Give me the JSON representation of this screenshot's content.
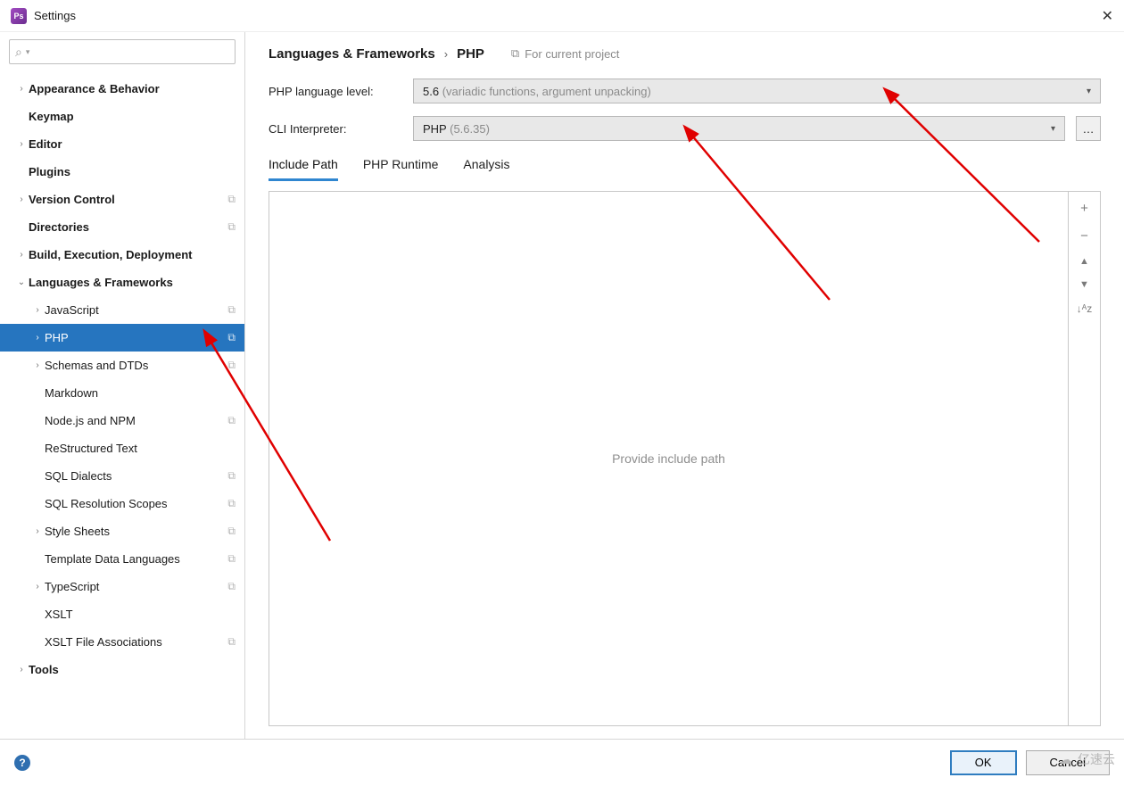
{
  "window": {
    "title": "Settings"
  },
  "sidebar": {
    "search_placeholder": "",
    "items": [
      {
        "label": "Appearance & Behavior",
        "bold": true,
        "arrow": "right",
        "depth": 1
      },
      {
        "label": "Keymap",
        "bold": true,
        "arrow": "none",
        "depth": 1
      },
      {
        "label": "Editor",
        "bold": true,
        "arrow": "right",
        "depth": 1
      },
      {
        "label": "Plugins",
        "bold": true,
        "arrow": "none",
        "depth": 1
      },
      {
        "label": "Version Control",
        "bold": true,
        "arrow": "right",
        "depth": 1,
        "badge": true
      },
      {
        "label": "Directories",
        "bold": true,
        "arrow": "none",
        "depth": 1,
        "badge": true
      },
      {
        "label": "Build, Execution, Deployment",
        "bold": true,
        "arrow": "right",
        "depth": 1
      },
      {
        "label": "Languages & Frameworks",
        "bold": true,
        "arrow": "down",
        "depth": 1
      },
      {
        "label": "JavaScript",
        "arrow": "right",
        "depth": 2,
        "badge": true
      },
      {
        "label": "PHP",
        "arrow": "right",
        "depth": 2,
        "badge": true,
        "selected": true
      },
      {
        "label": "Schemas and DTDs",
        "arrow": "right",
        "depth": 2,
        "badge": true
      },
      {
        "label": "Markdown",
        "arrow": "none",
        "depth": 2
      },
      {
        "label": "Node.js and NPM",
        "arrow": "none",
        "depth": 2,
        "badge": true
      },
      {
        "label": "ReStructured Text",
        "arrow": "none",
        "depth": 2
      },
      {
        "label": "SQL Dialects",
        "arrow": "none",
        "depth": 2,
        "badge": true
      },
      {
        "label": "SQL Resolution Scopes",
        "arrow": "none",
        "depth": 2,
        "badge": true
      },
      {
        "label": "Style Sheets",
        "arrow": "right",
        "depth": 2,
        "badge": true
      },
      {
        "label": "Template Data Languages",
        "arrow": "none",
        "depth": 2,
        "badge": true
      },
      {
        "label": "TypeScript",
        "arrow": "right",
        "depth": 2,
        "badge": true
      },
      {
        "label": "XSLT",
        "arrow": "none",
        "depth": 2
      },
      {
        "label": "XSLT File Associations",
        "arrow": "none",
        "depth": 2,
        "badge": true
      },
      {
        "label": "Tools",
        "bold": true,
        "arrow": "right",
        "depth": 1
      }
    ]
  },
  "breadcrumb": {
    "a": "Languages & Frameworks",
    "b": "PHP",
    "project_hint": "For current project"
  },
  "fields": {
    "lang_level": {
      "label": "PHP language level:",
      "value": "5.6",
      "hint": " (variadic functions, argument unpacking)"
    },
    "cli": {
      "label": "CLI Interpreter:",
      "value": "PHP",
      "hint": " (5.6.35)"
    }
  },
  "tabs": [
    {
      "label": "Include Path",
      "active": true
    },
    {
      "label": "PHP Runtime",
      "active": false
    },
    {
      "label": "Analysis",
      "active": false
    }
  ],
  "pane": {
    "placeholder": "Provide include path"
  },
  "toolbar_icons": {
    "add": "+",
    "remove": "−",
    "up": "▲",
    "down": "▼",
    "sort": "↓ᴬz"
  },
  "buttons": {
    "ok": "OK",
    "cancel": "Cancel",
    "more": "…"
  },
  "watermark": "亿速云"
}
